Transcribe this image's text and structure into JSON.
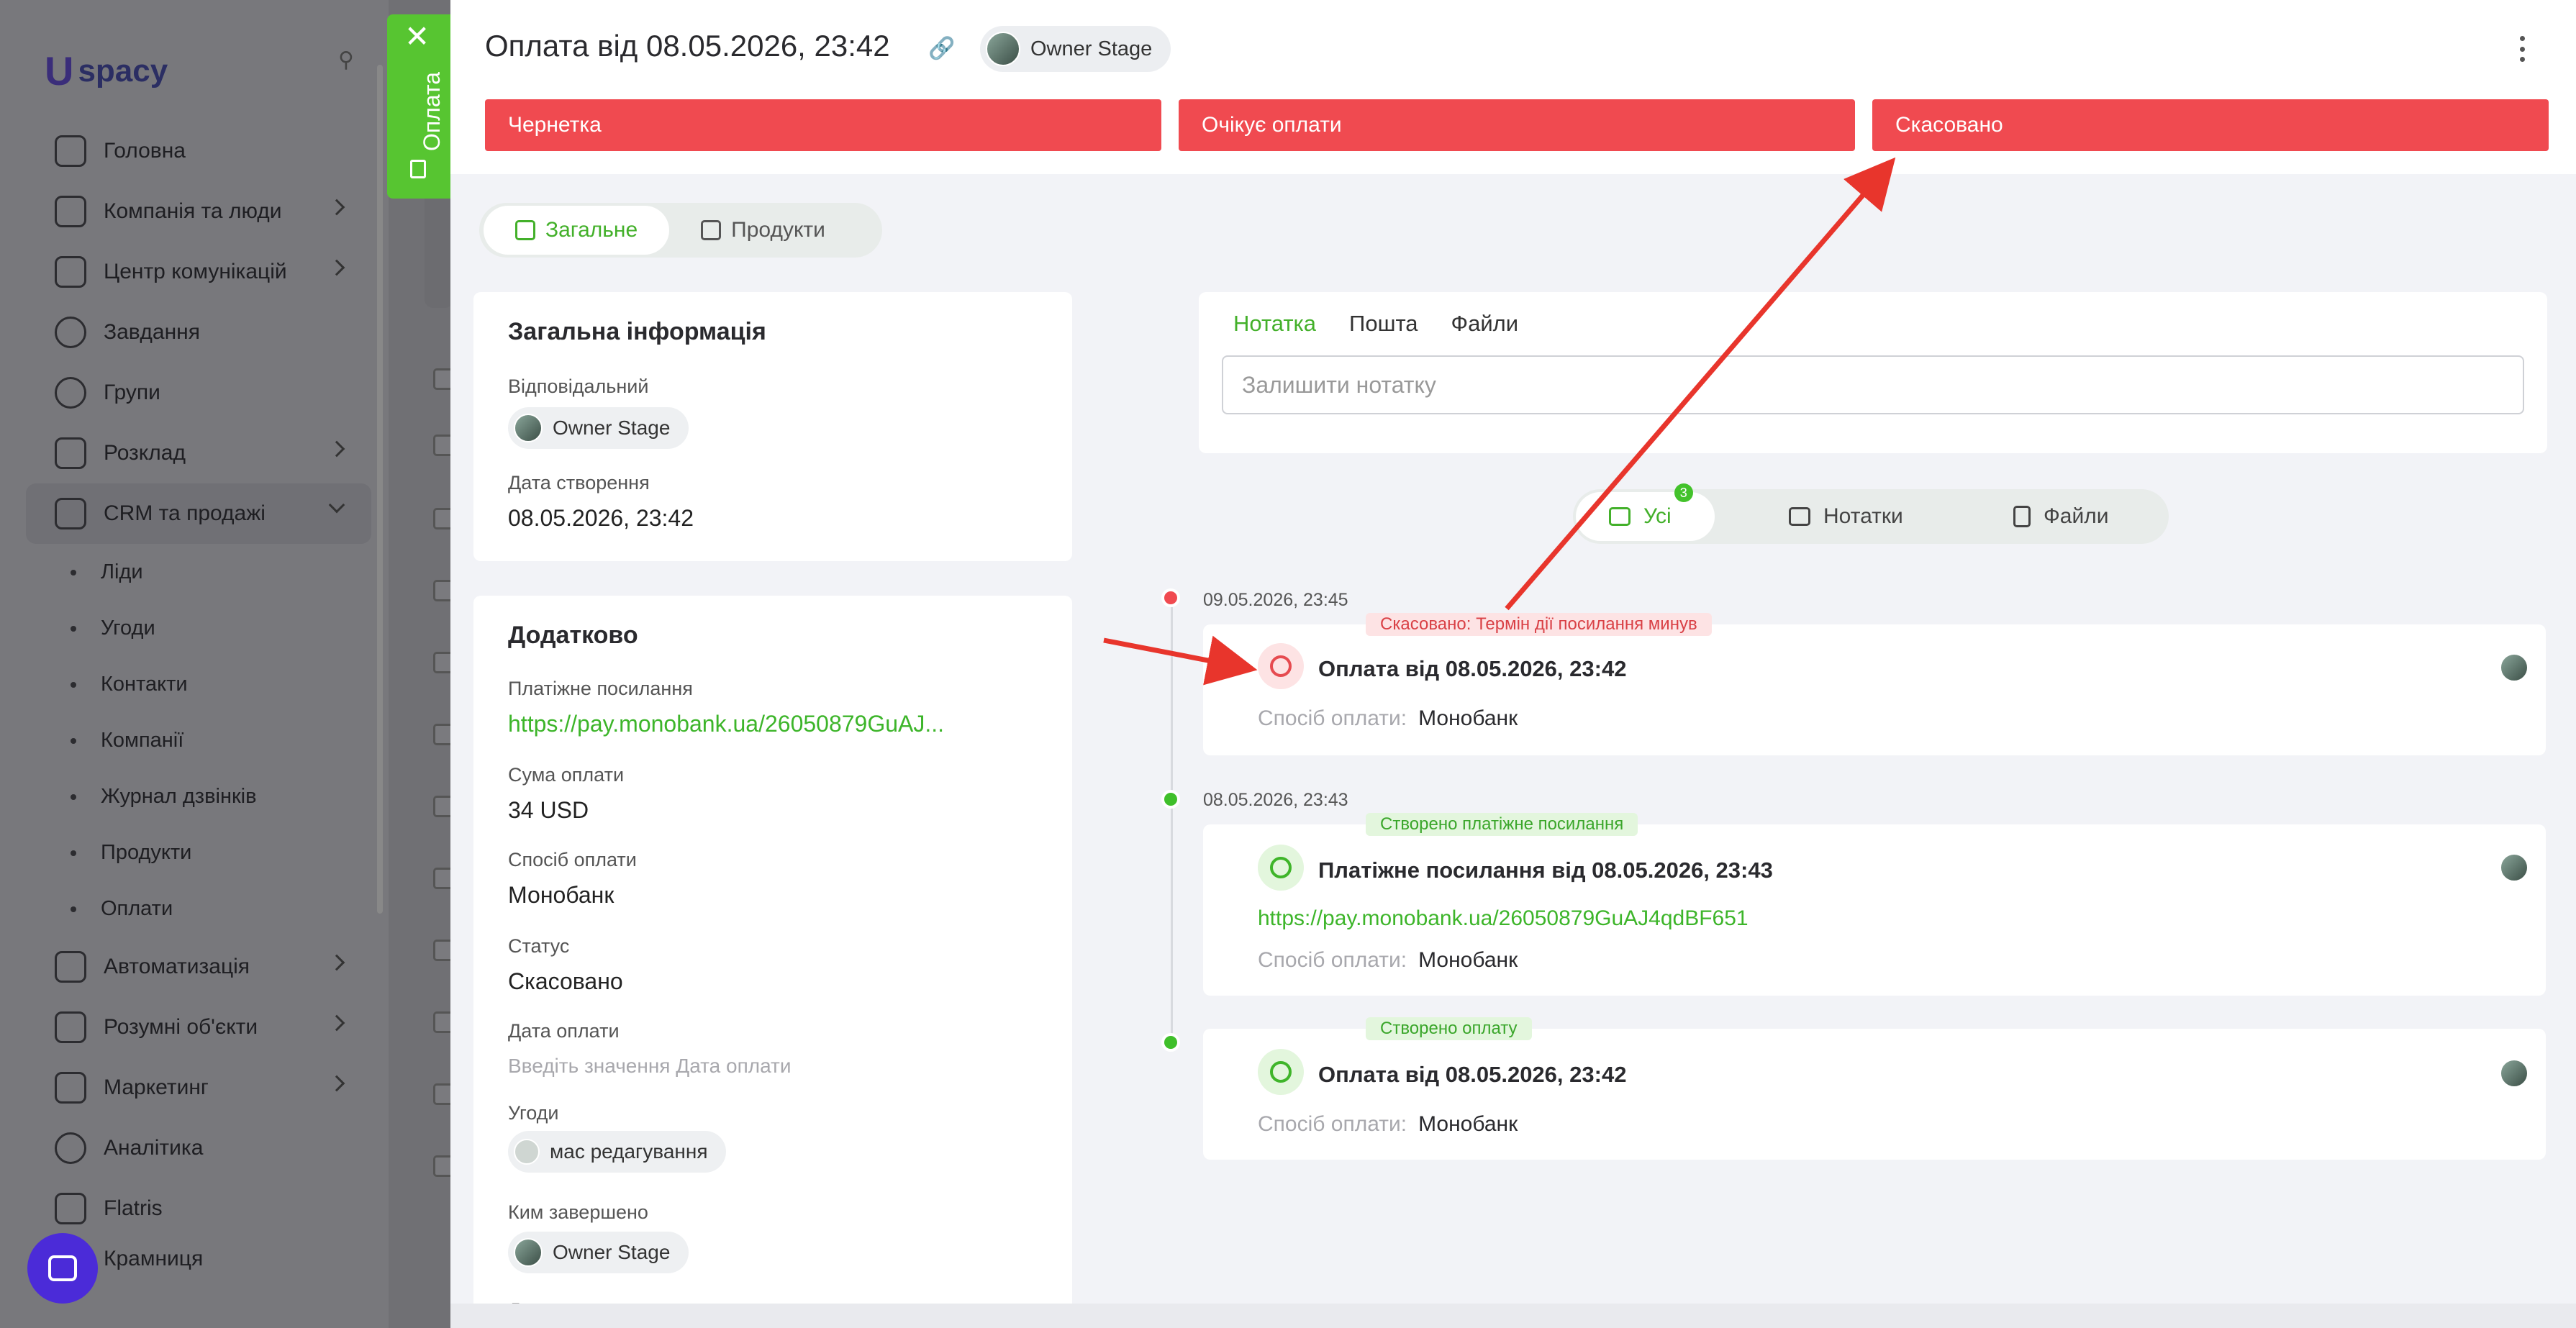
{
  "brand": {
    "logo_text": "spacy"
  },
  "sidebar": {
    "items": [
      {
        "label": "Головна",
        "icon": "home-icon"
      },
      {
        "label": "Компанія та люди",
        "icon": "company-icon",
        "chevron": "right"
      },
      {
        "label": "Центр комунікацій",
        "icon": "chat-icon",
        "chevron": "right"
      },
      {
        "label": "Завдання",
        "icon": "check-circle-icon"
      },
      {
        "label": "Групи",
        "icon": "users-icon"
      },
      {
        "label": "Розклад",
        "icon": "calendar-icon",
        "chevron": "right"
      },
      {
        "label": "CRM та продажі",
        "icon": "database-icon",
        "chevron": "down"
      }
    ],
    "sub_items": [
      "Ліди",
      "Угоди",
      "Контакти",
      "Компанії",
      "Журнал дзвінків",
      "Продукти",
      "Оплати"
    ],
    "items_after": [
      {
        "label": "Автоматизація",
        "icon": "lightning-icon",
        "chevron": "right"
      },
      {
        "label": "Розумні об'єкти",
        "icon": "smart-object-icon",
        "chevron": "right"
      },
      {
        "label": "Маркетинг",
        "icon": "marketing-icon",
        "chevron": "right"
      },
      {
        "label": "Аналітика",
        "icon": "analytics-icon"
      },
      {
        "label": "Flatris",
        "icon": "flatris-icon"
      },
      {
        "label": "Крамниця",
        "icon": "store-icon"
      }
    ]
  },
  "side_tab": {
    "label": "Оплата"
  },
  "header": {
    "title": "Оплата від 08.05.2026, 23:42",
    "owner": "Owner Stage",
    "stages": [
      "Чернетка",
      "Очікує оплати",
      "Скасовано"
    ]
  },
  "main_tabs": [
    {
      "label": "Загальне",
      "active": true
    },
    {
      "label": "Продукти",
      "active": false
    }
  ],
  "general_info": {
    "title": "Загальна інформація",
    "responsible_label": "Відповідальний",
    "responsible_value": "Owner Stage",
    "created_label": "Дата створення",
    "created_value": "08.05.2026, 23:42"
  },
  "additional": {
    "title": "Додатково",
    "payment_link_label": "Платіжне посилання",
    "payment_link_value": "https://pay.monobank.ua/26050879GuAJ...",
    "amount_label": "Сума оплати",
    "amount_value": "34 USD",
    "method_label": "Спосіб оплати",
    "method_value": "Монобанк",
    "status_label": "Статус",
    "status_value": "Скасовано",
    "paid_date_label": "Дата оплати",
    "paid_date_placeholder": "Введіть значення Дата оплати",
    "deals_label": "Угоди",
    "deals_value": "мас редагування",
    "completed_by_label": "Ким завершено",
    "completed_by_value": "Owner Stage",
    "completed_date_label": "Дата завершення"
  },
  "note": {
    "tabs": [
      "Нотатка",
      "Пошта",
      "Файли"
    ],
    "placeholder": "Залишити нотатку"
  },
  "filter_tabs": {
    "all_label": "Усі",
    "all_count": "3",
    "notes_label": "Нотатки",
    "files_label": "Файли"
  },
  "timeline": [
    {
      "time": "09.05.2026, 23:45",
      "tag": "Скасовано: Термін дії посилання минув",
      "title": "Оплата від 08.05.2026, 23:42",
      "method_label": "Спосіб оплати:",
      "method_value": "Монобанк"
    },
    {
      "time": "08.05.2026, 23:43",
      "tag": "Створено платіжне посилання",
      "title": "Платіжне посилання від 08.05.2026, 23:43",
      "link": "https://pay.monobank.ua/26050879GuAJ4qdBF651",
      "method_label": "Спосіб оплати:",
      "method_value": "Монобанк"
    },
    {
      "tag": "Створено оплату",
      "title": "Оплата від 08.05.2026, 23:42",
      "method_label": "Спосіб оплати:",
      "method_value": "Монобанк"
    }
  ],
  "colors": {
    "accent_green": "#43b02a",
    "stage_red": "#f04a50",
    "annotation_red": "#e8352c",
    "brand_purple": "#4b2bd8"
  }
}
